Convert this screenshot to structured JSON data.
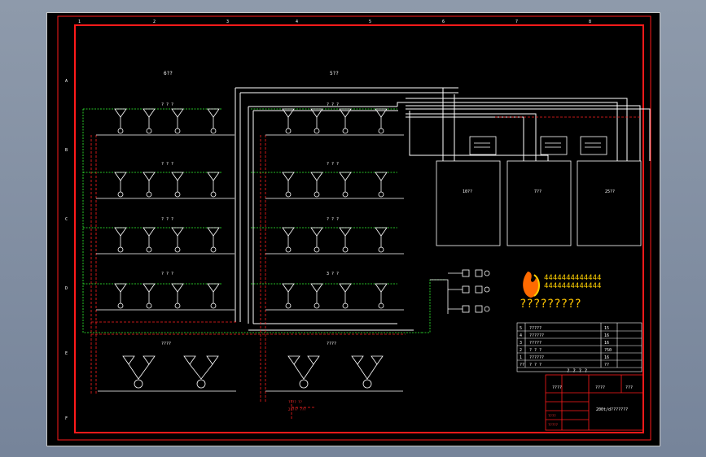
{
  "border_ticks": {
    "top": [
      "1",
      "2",
      "3",
      "4",
      "5",
      "6",
      "7",
      "8"
    ],
    "side": [
      "A",
      "B",
      "C",
      "D",
      "E",
      "F"
    ]
  },
  "zones": {
    "left_header": "6??",
    "right_header": "5??",
    "bottom_left_label": "????",
    "bottom_right_label": "????"
  },
  "row_labels": {
    "left": [
      "? ? ?",
      "? ? ?",
      "? ? ?",
      "? ? ?"
    ],
    "right": [
      "? ? ?",
      "? ? ?",
      "? ? ?",
      "3 ? ?"
    ]
  },
  "boilers": {
    "labels": [
      "10??",
      "7??",
      "25??"
    ]
  },
  "notes": {
    "note1": "???? ??",
    "note2": "2???? ???"
  },
  "logo": {
    "digits": "4444444444444",
    "question_line": "?????????"
  },
  "bom": {
    "rows": [
      {
        "no": "5",
        "name": "?????",
        "qty": "15"
      },
      {
        "no": "4",
        "name": "??????",
        "qty": "16"
      },
      {
        "no": "3",
        "name": "?????",
        "qty": "16"
      },
      {
        "no": "2",
        "name": "? ? ?",
        "qty": "?50"
      },
      {
        "no": "1",
        "name": "??????",
        "qty": "16"
      },
      {
        "no": "??",
        "name": "? ? ?",
        "qty": "??"
      }
    ],
    "caption": "? ? ? ?"
  },
  "title_block": {
    "field_a": "????",
    "field_b": "????",
    "field_c": "???",
    "drawing_title": "200t/d???????",
    "scale_note": "????",
    "footer": "?????"
  },
  "colors": {
    "frame_red": "#ff1a1a",
    "pipe_white": "#ffffff",
    "pipe_green": "#33ff33",
    "logo_yellow": "#ffd000",
    "logo_orange": "#ff6a00"
  }
}
